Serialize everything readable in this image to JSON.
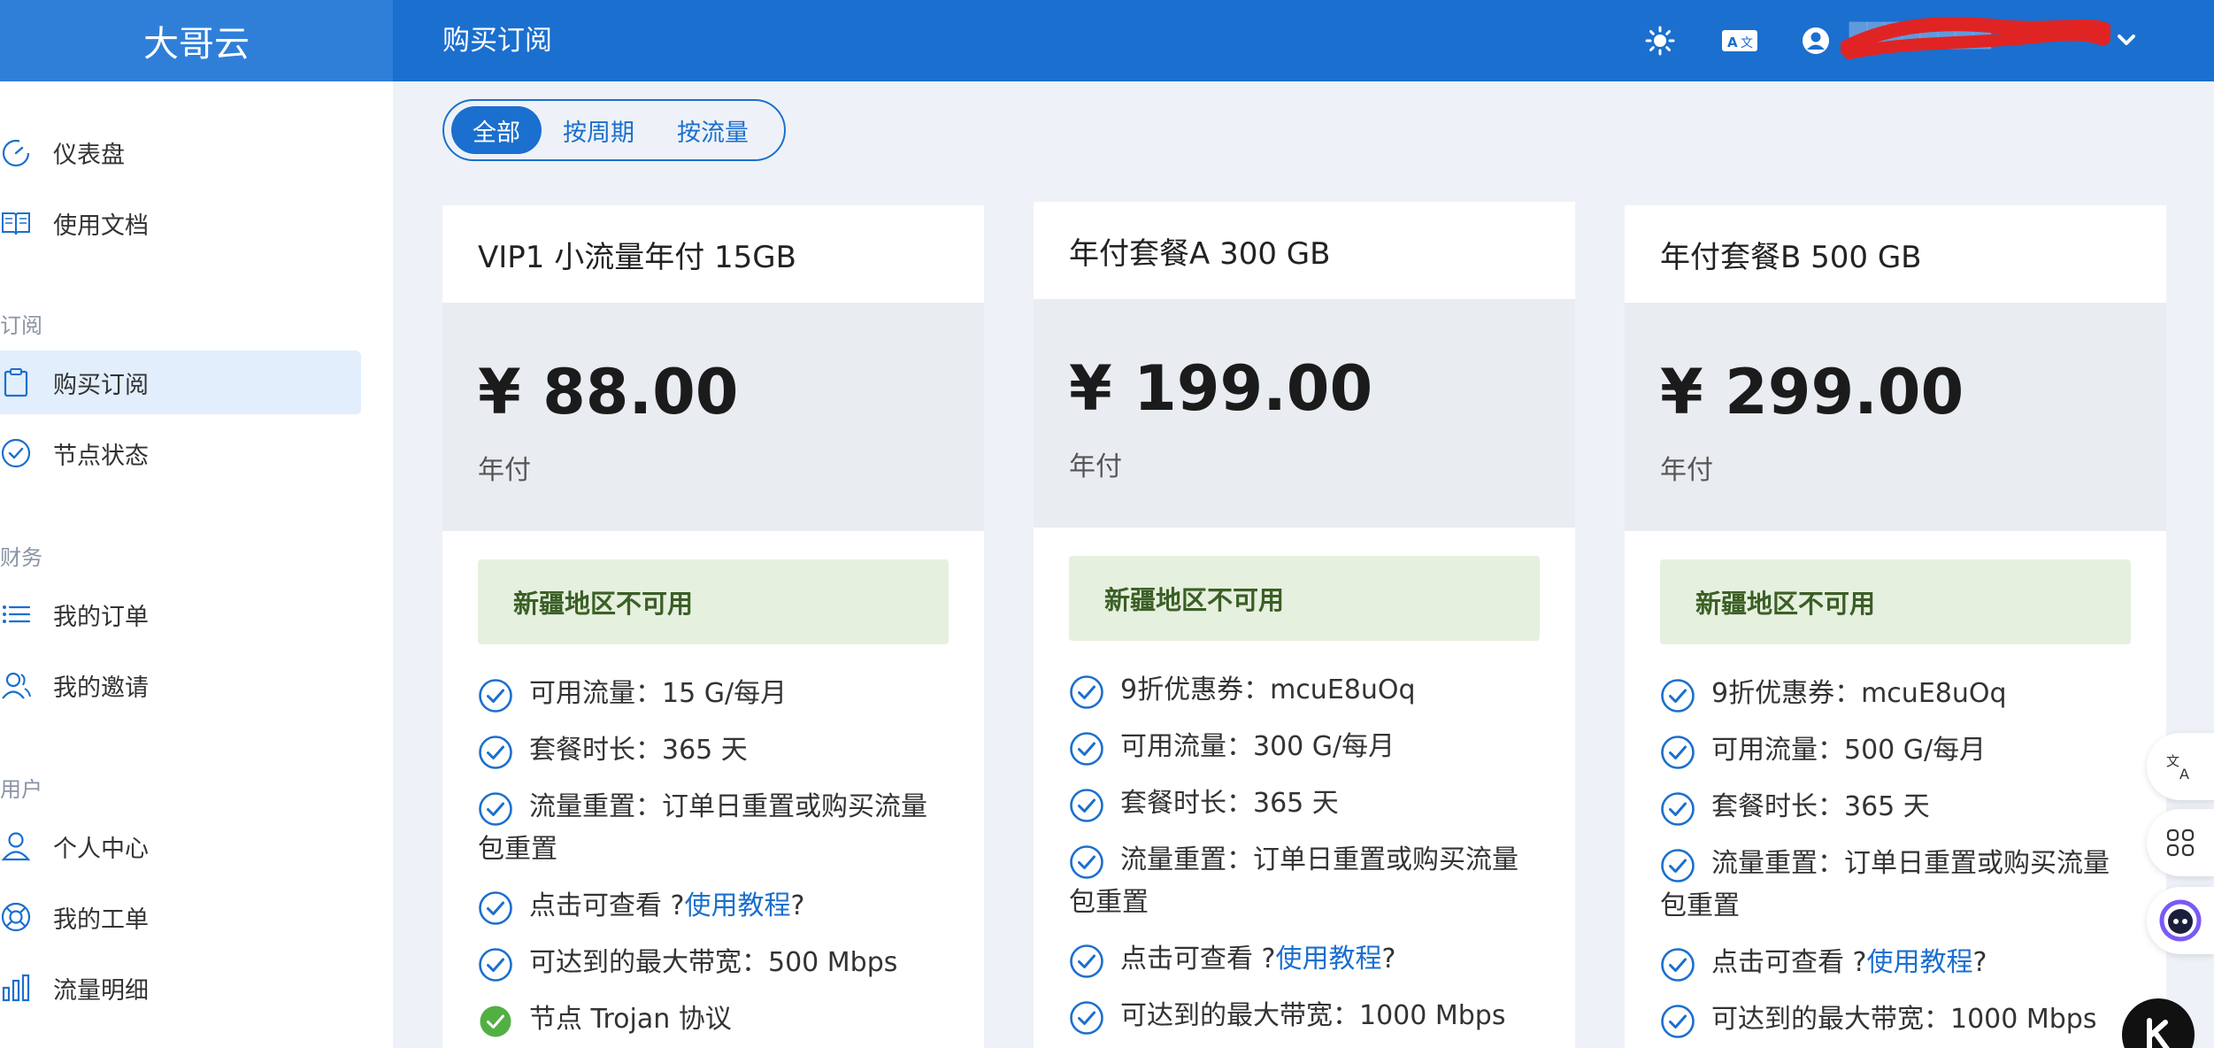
{
  "header": {
    "brand": "大哥云",
    "page_title": "购买订阅",
    "user_name": "████████"
  },
  "sidebar": {
    "items": [
      {
        "label": "仪表盘",
        "icon": "gauge-icon"
      },
      {
        "label": "使用文档",
        "icon": "book-icon"
      },
      {
        "label": "购买订阅",
        "icon": "clipboard-icon",
        "active": true
      },
      {
        "label": "节点状态",
        "icon": "check-circle-icon"
      },
      {
        "label": "我的订单",
        "icon": "list-icon"
      },
      {
        "label": "我的邀请",
        "icon": "users-icon"
      },
      {
        "label": "个人中心",
        "icon": "user-icon"
      },
      {
        "label": "我的工单",
        "icon": "lifebuoy-icon"
      },
      {
        "label": "流量明细",
        "icon": "bar-chart-icon"
      }
    ],
    "sections": [
      "订阅",
      "财务",
      "用户"
    ]
  },
  "tabs": [
    "全部",
    "按周期",
    "按流量"
  ],
  "plans": [
    {
      "title": "VIP1 小流量年付 15GB",
      "price": "¥ 88.00",
      "period": "年付",
      "notice": "新疆地区不可用",
      "features": [
        {
          "text": "可用流量：15 G/每月"
        },
        {
          "text": "套餐时长：365 天"
        },
        {
          "text": "流量重置：订单日重置或购买流量包重置"
        },
        {
          "prefix": "点击可查看 ?",
          "link": "使用教程",
          "suffix": "?"
        },
        {
          "text": "可达到的最大带宽：500 Mbps"
        },
        {
          "text": "节点 Trojan 协议",
          "filled": true
        }
      ]
    },
    {
      "title": "年付套餐A 300 GB",
      "price": "¥ 199.00",
      "period": "年付",
      "notice": "新疆地区不可用",
      "features": [
        {
          "text": "9折优惠券：mcuE8uOq"
        },
        {
          "text": "可用流量：300 G/每月"
        },
        {
          "text": "套餐时长：365 天"
        },
        {
          "text": "流量重置：订单日重置或购买流量包重置"
        },
        {
          "prefix": "点击可查看 ?",
          "link": "使用教程",
          "suffix": "?"
        },
        {
          "text": "可达到的最大带宽：1000 Mbps"
        }
      ]
    },
    {
      "title": "年付套餐B 500 GB",
      "price": "¥ 299.00",
      "period": "年付",
      "notice": "新疆地区不可用",
      "features": [
        {
          "text": "9折优惠券：mcuE8uOq"
        },
        {
          "text": "可用流量：500 G/每月"
        },
        {
          "text": "套餐时长：365 天"
        },
        {
          "text": "流量重置：订单日重置或购买流量包重置"
        },
        {
          "prefix": "点击可查看 ?",
          "link": "使用教程",
          "suffix": "?"
        },
        {
          "text": "可达到的最大带宽：1000 Mbps"
        }
      ]
    }
  ],
  "colors": {
    "primary": "#1b6fce",
    "notice_bg": "#e6f0de",
    "notice_text": "#3b5f26",
    "check_filled": "#52b043"
  },
  "floating_buttons": [
    "translate-icon",
    "apps-icon",
    "assistant-icon"
  ]
}
